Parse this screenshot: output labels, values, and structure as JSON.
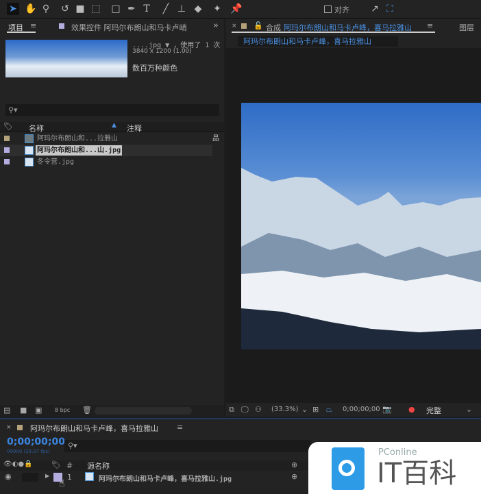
{
  "toolbar": {
    "snap_label": "对齐",
    "tools": [
      "selection-tool",
      "hand-tool",
      "zoom-tool",
      "rotate-tool",
      "camera-tool",
      "pan-behind-tool",
      "rectangle-tool",
      "pen-tool",
      "text-tool",
      "brush-tool",
      "clone-stamp-tool",
      "eraser-tool",
      "roto-brush-tool",
      "puppet-pin-tool"
    ]
  },
  "project_panel": {
    "tab_label": "项目",
    "effects_tab_label": "效果控件 阿玛尔布朗山和马卡卢峭",
    "overflow": "»",
    "preview": {
      "name": "....jpg ▼ ，使用了 1 次",
      "dimensions": "3840 x 1200 (1.00)",
      "colors": "数百万种颜色"
    },
    "columns": {
      "name": "名称",
      "comment": "注释"
    },
    "items": [
      {
        "name": "阿玛尔布朗山和...拉雅山",
        "swatch": "#b5a27a",
        "type": "composition"
      },
      {
        "name": "阿玛尔布朗山和...山.jpg",
        "swatch": "#b4aee0",
        "type": "image"
      },
      {
        "name": "冬令营.jpg",
        "swatch": "#b4aee0",
        "type": "image"
      }
    ],
    "bpc": "8 bpc"
  },
  "comp_panel": {
    "tab_prefix": "合成",
    "comp_name": "阿玛尔布朗山和马卡卢峰，喜马拉雅山",
    "layer_tab": "图层",
    "breadcrumb": "阿玛尔布朗山和马卡卢峰，喜马拉雅山",
    "zoom": "(33.3%)",
    "timecode": "0;00;00;00",
    "quality": "完整"
  },
  "timeline": {
    "comp_name": "阿玛尔布朗山和马卡卢峰，喜马拉雅山",
    "timecode": "0;00;00;00",
    "frame_info": "00000 (29.97 fps)",
    "col_num": "#",
    "col_source": "源名称",
    "layers": [
      {
        "index": "1",
        "name": "阿玛尔布朗山和马卡卢峰，喜马拉雅山.jpg",
        "swatch": "#b4aee0"
      }
    ]
  },
  "watermark": {
    "brand": "PConline",
    "title": "IT百科"
  }
}
